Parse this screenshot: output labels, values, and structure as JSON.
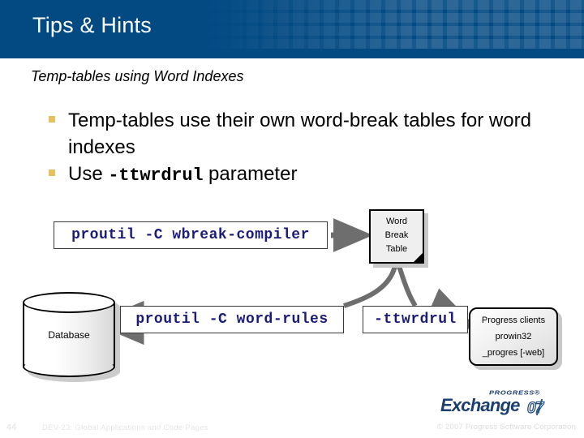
{
  "header": {
    "title": "Tips & Hints",
    "background_color": "#034a83",
    "title_color": "#ffffff"
  },
  "subtitle": "Temp-tables using Word Indexes",
  "bullets": [
    {
      "text_before": "Temp-tables use their own word-break tables for word indexes",
      "code": "",
      "text_after": ""
    },
    {
      "text_before": "Use ",
      "code": "-ttwrdrul",
      "text_after": " parameter"
    }
  ],
  "bullet_marker_color": "#e6c15c",
  "diagram": {
    "command_boxes": [
      {
        "name": "wbreak-compiler",
        "text": "proutil -C wbreak-compiler"
      },
      {
        "name": "word-rules",
        "text": "proutil -C word-rules"
      },
      {
        "name": "ttwrdrul",
        "text": "-ttwrdrul"
      }
    ],
    "command_text_color": "#1b1b7a",
    "word_break_table": {
      "lines": [
        "Word",
        "Break",
        "Table"
      ]
    },
    "database": {
      "label": "Database"
    },
    "progress_clients": {
      "lines": [
        "Progress clients",
        "prowin32",
        "_progres [-web]"
      ]
    },
    "arrow_color": "#6e6e6e"
  },
  "footer": {
    "page_number": "44",
    "course": "DEV-23: Global Applications and Code Pages",
    "copyright": "© 2007 Progress Software Corporation"
  },
  "logo": {
    "progress": "PROGRESS®",
    "exchange": "Exchange",
    "year": "07"
  }
}
